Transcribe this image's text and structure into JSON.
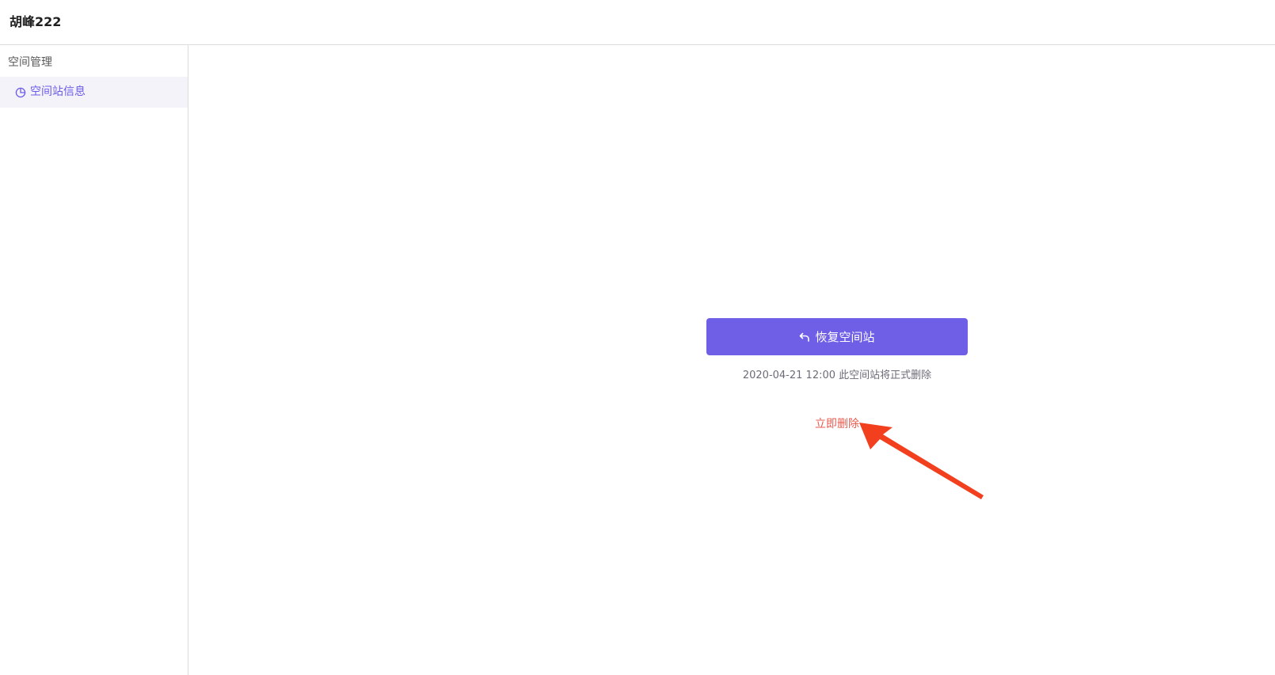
{
  "header": {
    "title": "胡峰222"
  },
  "sidebar": {
    "section_title": "空间管理",
    "items": [
      {
        "label": "空间站信息",
        "icon": "pie-chart-icon",
        "active": true
      }
    ]
  },
  "main": {
    "restore_button": {
      "label": "恢复空间站",
      "icon": "undo-arrow-icon"
    },
    "delete_note": "2020-04-21 12:00 此空间站将正式删除",
    "delete_now_label": "立即删除"
  },
  "colors": {
    "accent": "#6f5ee6",
    "active_item_bg": "#f4f3fa",
    "active_item_text": "#6b5ce7",
    "danger_text": "#e85a4f",
    "annotation_arrow": "#f2401f"
  },
  "annotation": {
    "icon": "red-pointer-arrow-icon"
  }
}
